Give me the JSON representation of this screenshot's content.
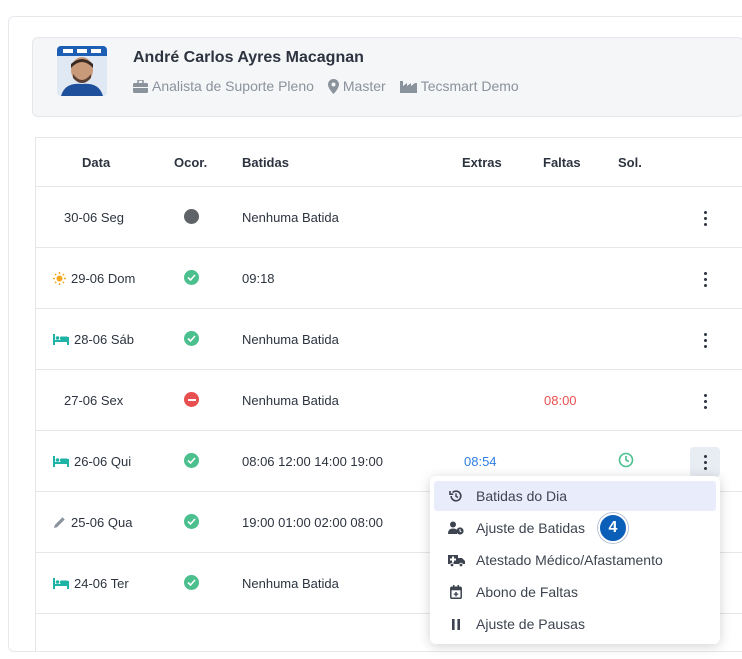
{
  "profile": {
    "name": "André Carlos Ayres Macagnan",
    "role": "Analista de Suporte Pleno",
    "location": "Master",
    "company": "Tecsmart Demo"
  },
  "table": {
    "headers": {
      "date": "Data",
      "occ": "Ocor.",
      "punches": "Batidas",
      "extras": "Extras",
      "absences": "Faltas",
      "sol": "Sol."
    },
    "rows": [
      {
        "date": "30-06 Seg",
        "icon": "",
        "status": "gray",
        "punches": "Nenhuma Batida",
        "extras": "",
        "absences": "",
        "sol": ""
      },
      {
        "date": "29-06 Dom",
        "icon": "sun-icon",
        "status": "ok",
        "punches": "09:18",
        "extras": "",
        "absences": "",
        "sol": ""
      },
      {
        "date": "28-06 Sáb",
        "icon": "bed-icon",
        "status": "ok",
        "punches": "Nenhuma Batida",
        "extras": "",
        "absences": "",
        "sol": ""
      },
      {
        "date": "27-06 Sex",
        "icon": "",
        "status": "error",
        "punches": "Nenhuma Batida",
        "extras": "",
        "absences": "08:00",
        "sol": ""
      },
      {
        "date": "26-06 Qui",
        "icon": "bed-icon",
        "status": "ok",
        "punches": "08:06 12:00 14:00 19:00",
        "extras": "08:54",
        "absences": "",
        "sol": "clock-icon"
      },
      {
        "date": "25-06 Qua",
        "icon": "pencil-icon",
        "status": "ok",
        "punches": "19:00 01:00 02:00 08:00",
        "extras": "",
        "absences": "",
        "sol": ""
      },
      {
        "date": "24-06 Ter",
        "icon": "bed-icon",
        "status": "ok",
        "punches": "Nenhuma Batida",
        "extras": "",
        "absences": "",
        "sol": ""
      }
    ]
  },
  "menu": {
    "items": [
      {
        "label": "Batidas do Dia",
        "icon": "history-icon"
      },
      {
        "label": "Ajuste de Batidas",
        "icon": "user-clock-icon"
      },
      {
        "label": "Atestado Médico/Afastamento",
        "icon": "ambulance-icon"
      },
      {
        "label": "Abono de Faltas",
        "icon": "calendar-plus-icon"
      },
      {
        "label": "Ajuste de Pausas",
        "icon": "pause-icon"
      }
    ]
  },
  "badge": {
    "number": "4"
  },
  "colors": {
    "ok": "#4cbf8f",
    "error": "#e8504f",
    "gray": "#5f6368",
    "extras": "#2f7fe0",
    "absences": "#e8504f",
    "icon_teal": "#1fb3a5",
    "sun": "#f5a623"
  }
}
